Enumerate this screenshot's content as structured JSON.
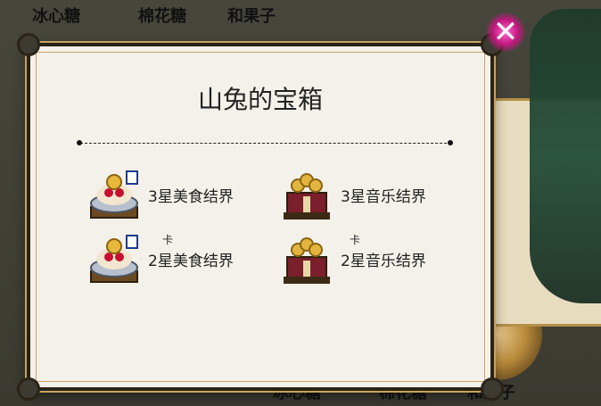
{
  "background": {
    "top_labels": [
      "冰心糖",
      "棉花糖",
      "和果子"
    ],
    "bottom_labels": [
      "冰心糖",
      "棉花糖",
      "和果子"
    ]
  },
  "dialog": {
    "title": "山兔的宝箱",
    "rewards": [
      {
        "label": "3星美食结界",
        "icon": "food-barrier-icon"
      },
      {
        "label": "3星音乐结界",
        "icon": "music-barrier-icon"
      },
      {
        "label": "2星美食结界",
        "icon": "food-barrier-icon"
      },
      {
        "label": "2星音乐结界",
        "icon": "music-barrier-icon"
      }
    ],
    "overlap_char": "卡"
  },
  "colors": {
    "accent_gold": "#c9a463",
    "close_glow": "#c2187f"
  }
}
